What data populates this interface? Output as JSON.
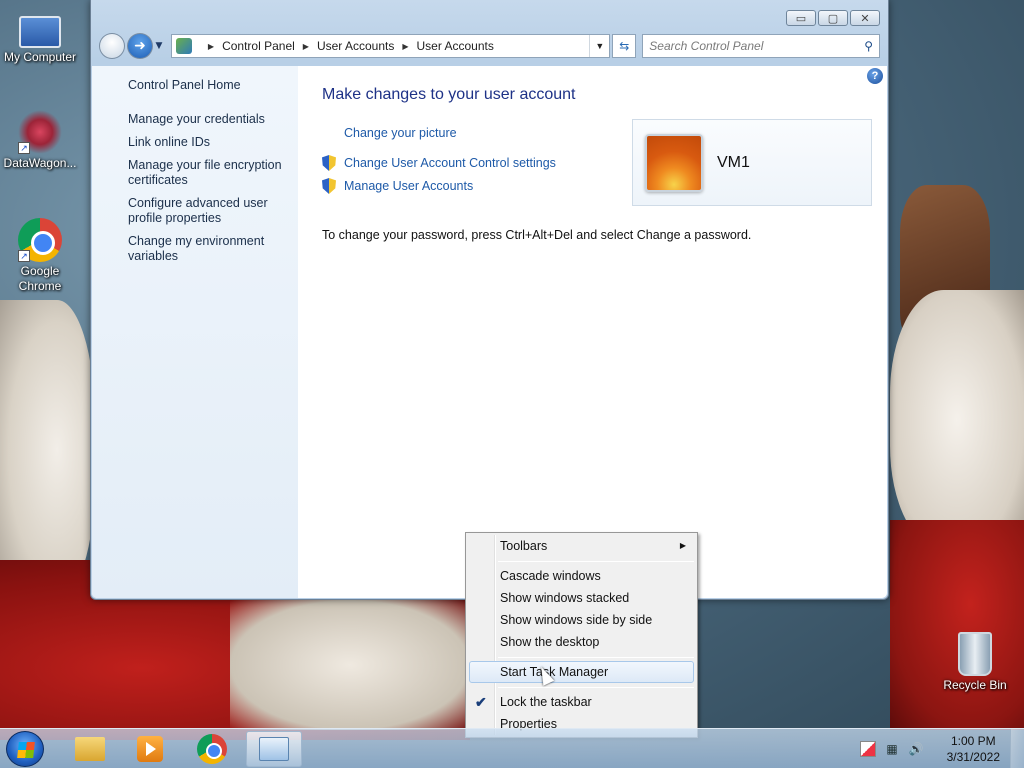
{
  "desktop": {
    "icons": [
      {
        "label": "My Computer"
      },
      {
        "label": "DataWagon..."
      },
      {
        "label": "Google Chrome"
      },
      {
        "label": "Recycle Bin"
      }
    ]
  },
  "window": {
    "controls": {
      "minimize": "▭",
      "maximize": "▢",
      "close": "✕"
    },
    "breadcrumb": [
      "Control Panel",
      "User Accounts",
      "User Accounts"
    ],
    "search_placeholder": "Search Control Panel",
    "sidebar": {
      "home": "Control Panel Home",
      "links": [
        "Manage your credentials",
        "Link online IDs",
        "Manage your file encryption certificates",
        "Configure advanced user profile properties",
        "Change my environment variables"
      ]
    },
    "main": {
      "title": "Make changes to your user account",
      "tasks": [
        {
          "label": "Change your picture",
          "shield": false
        },
        {
          "label": "Change User Account Control settings",
          "shield": true
        },
        {
          "label": "Manage User Accounts",
          "shield": true
        }
      ],
      "password_note": "To change your password, press Ctrl+Alt+Del and select Change a password.",
      "user_name": "VM1",
      "help": "?"
    }
  },
  "context_menu": {
    "items": [
      {
        "label": "Toolbars",
        "submenu": true
      },
      {
        "label": "Cascade windows"
      },
      {
        "label": "Show windows stacked"
      },
      {
        "label": "Show windows side by side"
      },
      {
        "label": "Show the desktop"
      },
      {
        "label": "Start Task Manager",
        "highlighted": true
      },
      {
        "label": "Lock the taskbar",
        "checked": true
      },
      {
        "label": "Properties"
      }
    ]
  },
  "taskbar": {
    "clock_time": "1:00 PM",
    "clock_date": "3/31/2022"
  }
}
